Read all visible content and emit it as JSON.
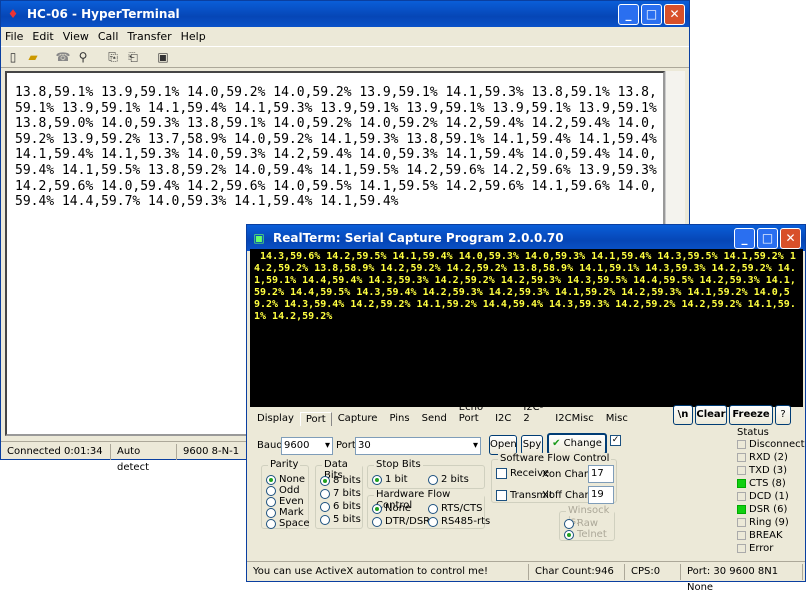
{
  "hyperterminal": {
    "title": "HC-06 - HyperTerminal",
    "menu": [
      "File",
      "Edit",
      "View",
      "Call",
      "Transfer",
      "Help"
    ],
    "text": "13.8,59.1% 13.9,59.1% 14.0,59.2% 14.0,59.2% 13.9,59.1% 14.1,59.3% 13.8,59.1% 13.8,59.1% 13.9,59.1% 14.1,59.4% 14.1,59.3% 13.9,59.1% 13.9,59.1% 13.9,59.1% 13.9,59.1% 13.8,59.0% 14.0,59.3% 13.8,59.1% 14.0,59.2% 14.0,59.2% 14.2,59.4% 14.2,59.4% 14.0,59.2% 13.9,59.2% 13.7,58.9% 14.0,59.2% 14.1,59.3% 13.8,59.1% 14.1,59.4% 14.1,59.4% 14.1,59.4% 14.1,59.3% 14.0,59.3% 14.2,59.4% 14.0,59.3% 14.1,59.4% 14.0,59.4% 14.0,59.4% 14.1,59.5% 13.8,59.2% 14.0,59.4% 14.1,59.5% 14.2,59.6% 14.2,59.6% 13.9,59.3% 14.2,59.6% 14.0,59.4% 14.2,59.6% 14.0,59.5% 14.1,59.5% 14.2,59.6% 14.1,59.6% 14.0,59.4% 14.4,59.7% 14.0,59.3% 14.1,59.4% 14.1,59.4%",
    "status": {
      "connected": "Connected 0:01:34",
      "detect": "Auto detect",
      "settings": "9600 8-N-1"
    }
  },
  "realterm": {
    "title": "RealTerm: Serial Capture Program 2.0.0.70",
    "terminal_text": " 14.3,59.6% 14.2,59.5% 14.1,59.4% 14.0,59.3% 14.0,59.3% 14.1,59.4% 14.3,59.5% 14.1,59.2% 14.2,59.2% 13.8,58.9% 14.2,59.2% 14.2,59.2% 13.8,58.9% 14.1,59.1% 14.3,59.3% 14.2,59.2% 14.1,59.1% 14.4,59.4% 14.3,59.3% 14.2,59.2% 14.2,59.3% 14.3,59.5% 14.4,59.5% 14.2,59.3% 14.1,59.2% 14.4,59.5% 14.3,59.4% 14.2,59.3% 14.2,59.3% 14.1,59.2% 14.2,59.3% 14.1,59.2% 14.0,59.2% 14.3,59.4% 14.2,59.2% 14.1,59.2% 14.4,59.4% 14.3,59.3% 14.2,59.2% 14.2,59.2% 14.1,59.1% 14.2,59.2%",
    "tabs": [
      "Display",
      "Port",
      "Capture",
      "Pins",
      "Send",
      "Echo Port",
      "I2C",
      "I2C-2",
      "I2CMisc",
      "Misc"
    ],
    "right_buttons": {
      "newline": "\\n",
      "clear": "Clear",
      "freeze": "Freeze",
      "help": "?"
    },
    "port": {
      "baud_label": "Baud",
      "baud_value": "9600",
      "port_label": "Port",
      "port_value": "30",
      "open": "Open",
      "spy": "Spy",
      "change": "Change",
      "parity": {
        "title": "Parity",
        "options": [
          "None",
          "Odd",
          "Even",
          "Mark",
          "Space"
        ]
      },
      "databits": {
        "title": "Data Bits",
        "options": [
          "8 bits",
          "7 bits",
          "6 bits",
          "5 bits"
        ]
      },
      "stopbits": {
        "title": "Stop Bits",
        "options": [
          "1 bit",
          "2 bits"
        ]
      },
      "hwflow": {
        "title": "Hardware Flow Control",
        "options": [
          "None",
          "RTS/CTS",
          "DTR/DSR",
          "RS485-rts"
        ]
      },
      "swflow": {
        "title": "Software Flow Control",
        "receive": "Receive",
        "transmit": "Transmit",
        "xon_label": "Xon Char:",
        "xon": "17",
        "xoff_label": "Xoff Char:",
        "xoff": "19"
      },
      "winsock": {
        "title": "Winsock is:",
        "options": [
          "Raw",
          "Telnet"
        ]
      }
    },
    "status": {
      "title": "Status",
      "items": [
        "Disconnect",
        "RXD (2)",
        "TXD (3)",
        "CTS (8)",
        "DCD (1)",
        "DSR (6)",
        "Ring (9)",
        "BREAK",
        "Error"
      ]
    },
    "statusbar": {
      "message": "You can use ActiveX automation to control me!",
      "chars": "Char Count:946",
      "cps": "CPS:0",
      "port": "Port: 30 9600 8N1 None"
    }
  },
  "colors": {
    "titlebar": "#0646b6",
    "terminal_fg": "#ffff40",
    "led_on": "#10d010"
  }
}
